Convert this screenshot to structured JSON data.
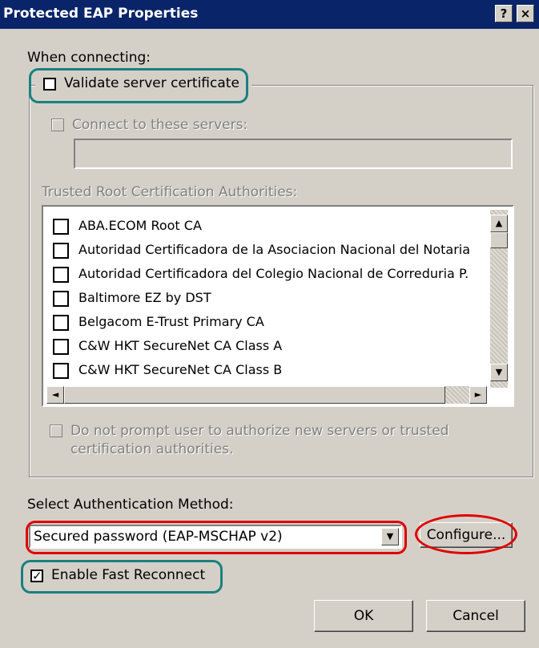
{
  "window": {
    "title": "Protected EAP Properties",
    "help_label": "?",
    "close_label": "×"
  },
  "when_connecting_label": "When connecting:",
  "validate_server_cert": {
    "label": "Validate server certificate",
    "checked": false
  },
  "connect_servers": {
    "label": "Connect to these servers:",
    "checked": false,
    "enabled": false,
    "value": ""
  },
  "trusted_root_label": "Trusted Root Certification Authorities:",
  "trusted_roots": [
    {
      "label": "ABA.ECOM Root CA",
      "checked": false
    },
    {
      "label": "Autoridad Certificadora de la Asociacion Nacional del Notaria",
      "checked": false
    },
    {
      "label": "Autoridad Certificadora del Colegio Nacional de Correduria P.",
      "checked": false
    },
    {
      "label": "Baltimore EZ by DST",
      "checked": false
    },
    {
      "label": "Belgacom E-Trust Primary CA",
      "checked": false
    },
    {
      "label": "C&W HKT SecureNet CA Class A",
      "checked": false
    },
    {
      "label": "C&W HKT SecureNet CA Class B",
      "checked": false
    }
  ],
  "do_not_prompt": {
    "label_line1": "Do not prompt user to authorize new servers or trusted",
    "label_line2": "certification authorities.",
    "checked": false
  },
  "auth_method_label": "Select Authentication Method:",
  "auth_method_value": "Secured password (EAP-MSCHAP v2)",
  "configure_label": "Configure...",
  "fast_reconnect": {
    "label": "Enable Fast Reconnect",
    "checked": true
  },
  "ok_label": "OK",
  "cancel_label": "Cancel",
  "icons": {
    "scroll_up": "▲",
    "scroll_down": "▼",
    "scroll_left": "◄",
    "scroll_right": "►",
    "check": "✓"
  },
  "colors": {
    "titlebar": "#0a246a",
    "highlight_teal": "#1a8080",
    "highlight_red": "#e00000"
  }
}
